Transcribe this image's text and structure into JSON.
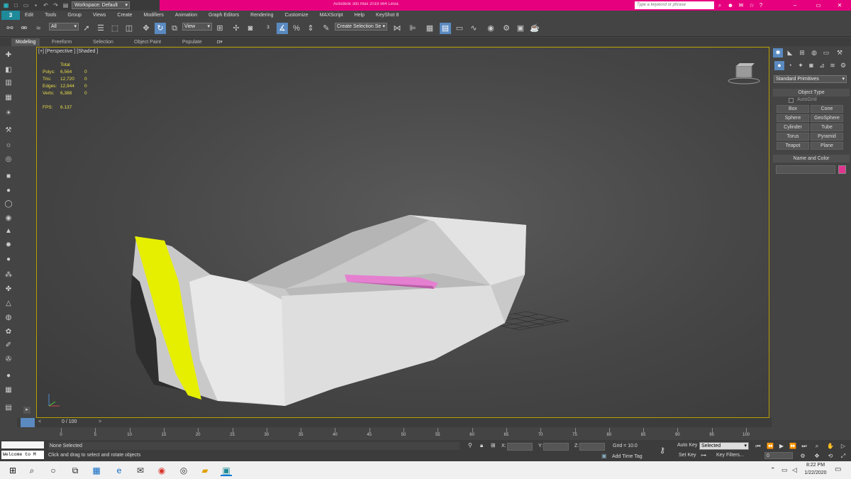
{
  "titlebar": {
    "workspace": "Workspace: Default",
    "title": "Autodesk 3ds Max  2019 x64     Lesia",
    "search_placeholder": "Type a keyword or phrase"
  },
  "menu": [
    "Edit",
    "Tools",
    "Group",
    "Views",
    "Create",
    "Modifiers",
    "Animation",
    "Graph Editors",
    "Rendering",
    "Customize",
    "MAXScript",
    "Help",
    "KeyShot 8"
  ],
  "toolbar": {
    "filter": "All",
    "refcoord": "View",
    "selection_set": "Create Selection Se"
  },
  "ribbon_tabs": [
    "Modeling",
    "Freeform",
    "Selection",
    "Object Paint",
    "Populate"
  ],
  "viewport": {
    "label": "[+] [Perspective ] [Shaded ]",
    "stats": {
      "header": "Total",
      "rows": [
        {
          "label": "Polys:",
          "total": "6,564",
          "sel": "0"
        },
        {
          "label": "Tris:",
          "total": "12,720",
          "sel": "0"
        },
        {
          "label": "Edges:",
          "total": "12,944",
          "sel": "0"
        },
        {
          "label": "Verts:",
          "total": "6,388",
          "sel": "0"
        }
      ],
      "fps_label": "FPS:",
      "fps": "6.137"
    },
    "colors": {
      "hull": "#d8d8d8",
      "bow": "#e6ef00",
      "seat": "#e57fd0"
    }
  },
  "cmdpanel": {
    "category": "Standard Primitives",
    "object_type_header": "Object Type",
    "autogrid": "AutoGrid",
    "primitives": [
      "Box",
      "Cone",
      "Sphere",
      "GeoSphere",
      "Cylinder",
      "Tube",
      "Torus",
      "Pyramid",
      "Teapot",
      "Plane"
    ],
    "name_color_header": "Name and Color",
    "swatch": "#e0348f"
  },
  "timeline": {
    "frame_display": "0 / 100",
    "ticks": [
      "0",
      "5",
      "10",
      "15",
      "20",
      "25",
      "30",
      "35",
      "40",
      "45",
      "50",
      "55",
      "60",
      "65",
      "70",
      "75",
      "80",
      "85",
      "90",
      "95",
      "100"
    ]
  },
  "status": {
    "maxscript": "Welcome to M",
    "selected": "None Selected",
    "prompt": "Click and drag to select and rotate objects",
    "x_label": "X:",
    "y_label": "Y:",
    "z_label": "Z:",
    "grid": "Grid = 10.0",
    "add_time_tag": "Add Time Tag",
    "auto_key": "Auto Key",
    "key_mode": "Selected",
    "set_key": "Set Key",
    "key_filters": "Key Filters...",
    "frame": "0"
  },
  "taskbar": {
    "time": "8:22 PM",
    "date": "1/22/2020"
  }
}
